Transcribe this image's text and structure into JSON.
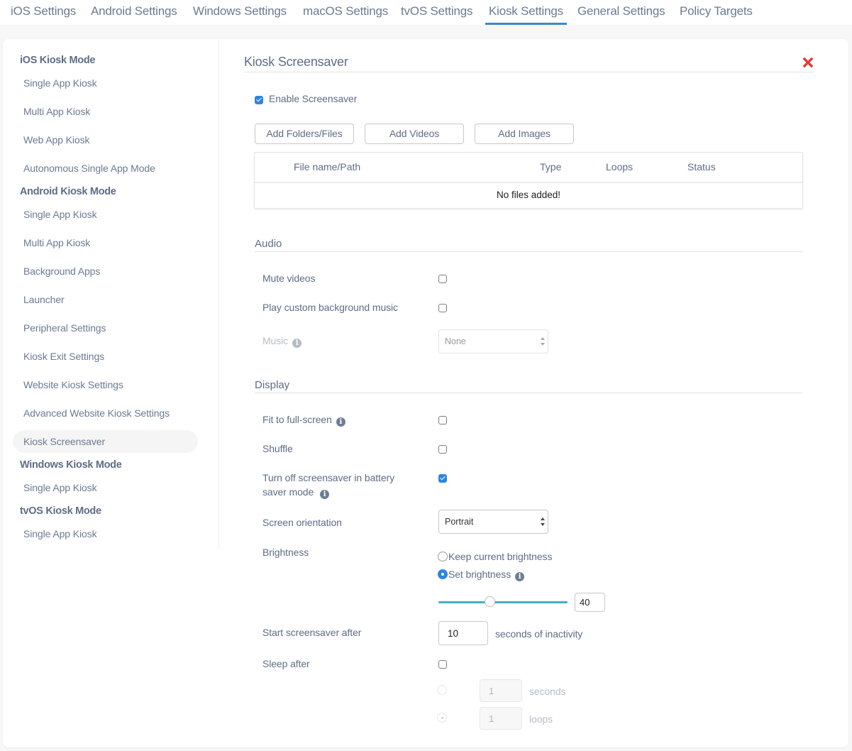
{
  "top_tabs": [
    {
      "label": "iOS Settings",
      "active": false
    },
    {
      "label": "Android Settings",
      "active": false
    },
    {
      "label": "Windows Settings",
      "active": false
    },
    {
      "label": "macOS Settings",
      "active": false
    },
    {
      "label": "tvOS Settings",
      "active": false
    },
    {
      "label": "Kiosk Settings",
      "active": true
    },
    {
      "label": "General Settings",
      "active": false
    },
    {
      "label": "Policy Targets",
      "active": false
    }
  ],
  "sidebar": {
    "groups": [
      {
        "heading": "iOS Kiosk Mode",
        "items": [
          "Single App Kiosk",
          "Multi App Kiosk",
          "Web App Kiosk",
          "Autonomous Single App Mode"
        ]
      },
      {
        "heading": "Android Kiosk Mode",
        "items": [
          "Single App Kiosk",
          "Multi App Kiosk",
          "Background Apps",
          "Launcher",
          "Peripheral Settings",
          "Kiosk Exit Settings",
          "Website Kiosk Settings",
          "Advanced Website Kiosk Settings",
          "Kiosk Screensaver"
        ]
      },
      {
        "heading": "Windows Kiosk Mode",
        "items": [
          "Single App Kiosk"
        ]
      },
      {
        "heading": "tvOS Kiosk Mode",
        "items": [
          "Single App Kiosk"
        ]
      }
    ],
    "active_item": "Kiosk Screensaver"
  },
  "main": {
    "title": "Kiosk Screensaver",
    "close_icon": "close-x-icon",
    "close_color": "#e53935",
    "enable_screensaver": {
      "label": "Enable Screensaver",
      "checked": true
    },
    "buttons": {
      "add_folders": "Add Folders/Files",
      "add_videos": "Add Videos",
      "add_images": "Add Images"
    },
    "file_table": {
      "columns": [
        "File name/Path",
        "Type",
        "Loops",
        "Status"
      ],
      "empty_message": "No files added!"
    },
    "audio": {
      "heading": "Audio",
      "mute_videos": {
        "label": "Mute videos",
        "checked": false
      },
      "play_music": {
        "label": "Play custom background music",
        "checked": false
      },
      "music": {
        "label": "Music",
        "value": "None",
        "disabled": true
      }
    },
    "display": {
      "heading": "Display",
      "fit_fullscreen": {
        "label": "Fit to full-screen",
        "checked": false
      },
      "shuffle": {
        "label": "Shuffle",
        "checked": false
      },
      "battery_saver": {
        "label_line1": "Turn off screensaver in battery",
        "label_line2": "saver mode",
        "checked": true
      },
      "orientation": {
        "label": "Screen orientation",
        "value": "Portrait"
      },
      "brightness": {
        "label": "Brightness",
        "keep_label": "Keep current brightness",
        "set_label": "Set brightness",
        "selected": "set",
        "value": "40",
        "slider_fraction": 0.4
      },
      "start_after": {
        "label": "Start screensaver after",
        "value": "10",
        "suffix": "seconds of inactivity"
      },
      "sleep_after": {
        "label": "Sleep after",
        "checked": false,
        "seconds_value": "1",
        "seconds_label": "seconds",
        "loops_value": "1",
        "loops_label": "loops",
        "selected": "loops"
      }
    }
  },
  "colors": {
    "accent": "#3f88c5",
    "checkbox_blue": "#2f84e4",
    "slider": "#45aec2",
    "text": "#5f6d86"
  }
}
